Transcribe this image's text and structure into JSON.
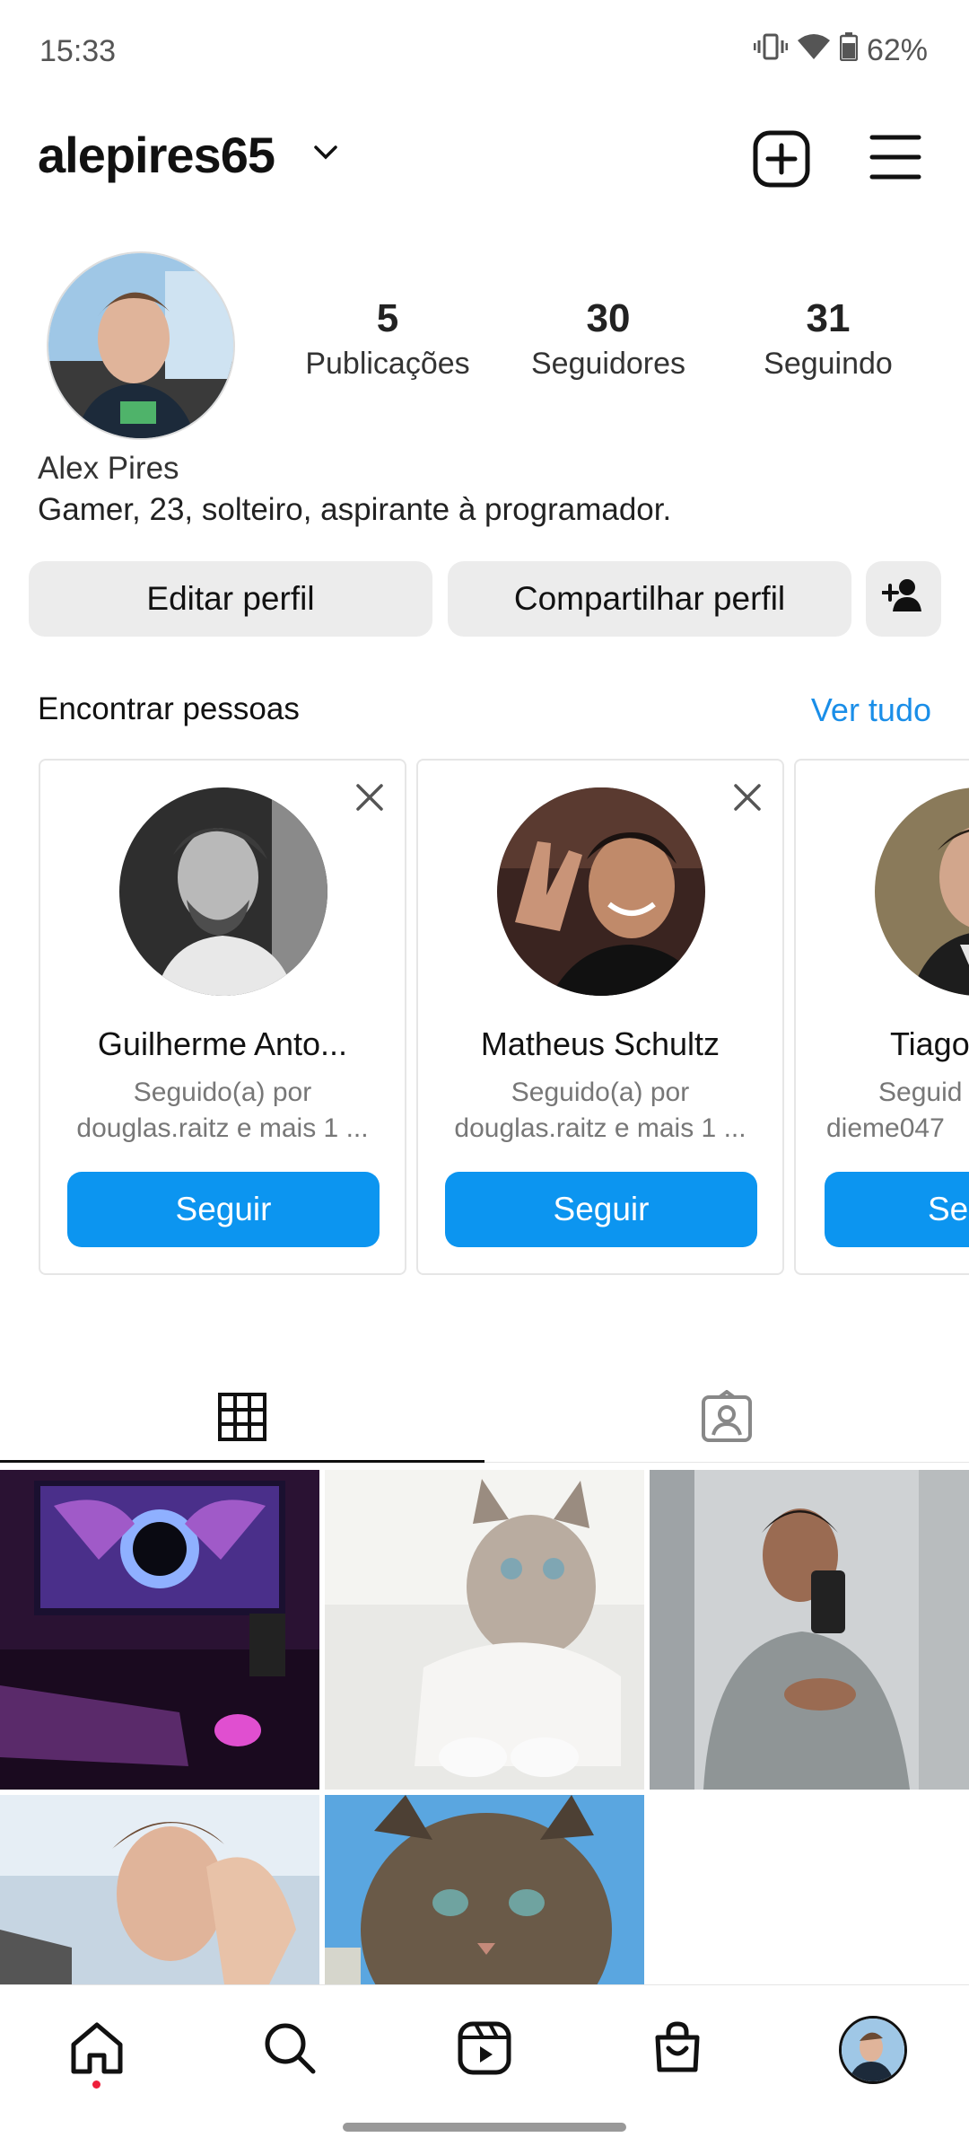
{
  "status_bar": {
    "time": "15:33",
    "battery": "62%"
  },
  "header": {
    "username": "alepires65"
  },
  "profile": {
    "stats": [
      {
        "value": "5",
        "label": "Publicações"
      },
      {
        "value": "30",
        "label": "Seguidores"
      },
      {
        "value": "31",
        "label": "Seguindo"
      }
    ],
    "full_name": "Alex Pires",
    "bio": "Gamer, 23, solteiro, aspirante à programador.",
    "edit_label": "Editar perfil",
    "share_label": "Compartilhar perfil"
  },
  "discover": {
    "title": "Encontrar pessoas",
    "see_all": "Ver tudo",
    "cards": [
      {
        "name": "Guilherme Anto...",
        "sub1": "Seguido(a) por",
        "sub2": "douglas.raitz e mais 1 ...",
        "button": "Seguir"
      },
      {
        "name": "Matheus Schultz",
        "sub1": "Seguido(a) por",
        "sub2": "douglas.raitz e mais 1 ...",
        "button": "Seguir"
      },
      {
        "name": "Tiago",
        "sub1": "Seguid",
        "sub2": "dieme047",
        "button": "Se"
      }
    ]
  },
  "colors": {
    "accent": "#0c95f0",
    "link": "#1a8ee8",
    "notification_dot": "#ee1f3a"
  },
  "icons": {
    "status": [
      "vibrate-icon",
      "wifi-icon",
      "battery-icon"
    ],
    "header": [
      "chevron-down-icon",
      "new-post-icon",
      "menu-icon"
    ],
    "tabs": [
      "grid-icon",
      "tagged-icon"
    ],
    "nav": [
      "home-icon",
      "search-icon",
      "reels-icon",
      "shop-icon",
      "profile-icon"
    ]
  }
}
